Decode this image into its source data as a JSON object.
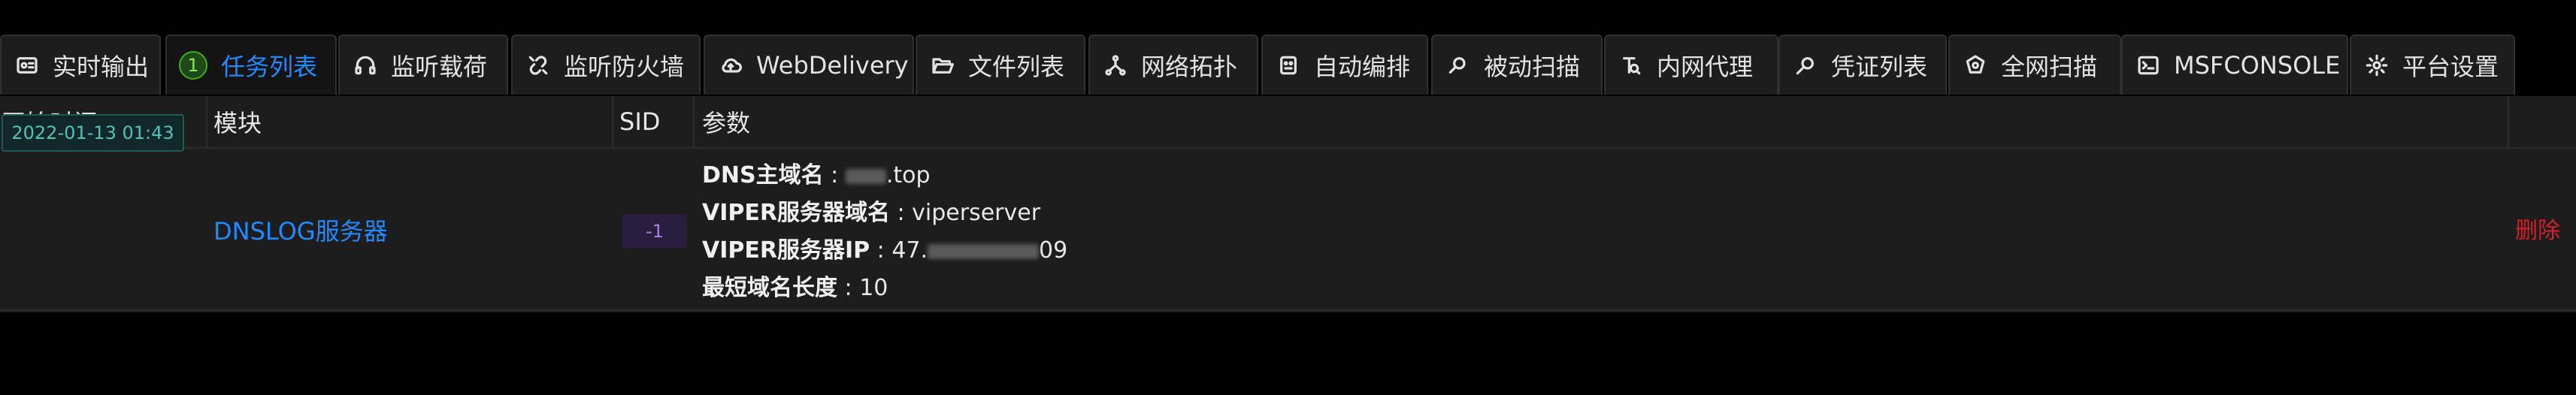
{
  "tabs": [
    {
      "label": "实时输出",
      "icon": "terminal-log-icon"
    },
    {
      "label": "任务列表",
      "badge": "1",
      "active": true
    },
    {
      "label": "监听载荷",
      "icon": "headphones-icon"
    },
    {
      "label": "监听防火墙",
      "icon": "link-broken-icon"
    },
    {
      "label": "WebDelivery",
      "icon": "cloud-upload-icon"
    },
    {
      "label": "文件列表",
      "icon": "folder-open-icon"
    },
    {
      "label": "网络拓扑",
      "icon": "network-topology-icon"
    },
    {
      "label": "自动编排",
      "icon": "robot-icon"
    },
    {
      "label": "被动扫描",
      "icon": "file-search-icon"
    },
    {
      "label": "内网代理",
      "icon": "node-proxy-icon"
    },
    {
      "label": "凭证列表",
      "icon": "key-search-icon"
    },
    {
      "label": "全网扫描",
      "icon": "radar-icon"
    },
    {
      "label": "MSFCONSOLE",
      "icon": "console-icon"
    },
    {
      "label": "平台设置",
      "icon": "gear-icon"
    }
  ],
  "table": {
    "headers": [
      "开始时间",
      "模块",
      "SID",
      "参数"
    ],
    "row": {
      "start_time": "2022-01-13 01:43",
      "module": "DNSLOG服务器",
      "sid": "-1",
      "params": [
        {
          "key": "DNS主域名",
          "value": ".top",
          "redacted": true
        },
        {
          "key": "VIPER服务器域名",
          "value": "viperserver"
        },
        {
          "key": "VIPER服务器IP",
          "value_prefix": "47.",
          "value_suffix": "09",
          "redacted": true
        },
        {
          "key": "最短域名长度",
          "value": "10"
        }
      ],
      "action": "删除"
    }
  },
  "colors": {
    "accent": "#1f8bff",
    "badge_green": "#49aa19",
    "time_tag": "#4fc3b5",
    "sid_tag": "#a77fe8",
    "delete": "#d32029",
    "background": "#000000",
    "panel": "#1d1d1d"
  }
}
